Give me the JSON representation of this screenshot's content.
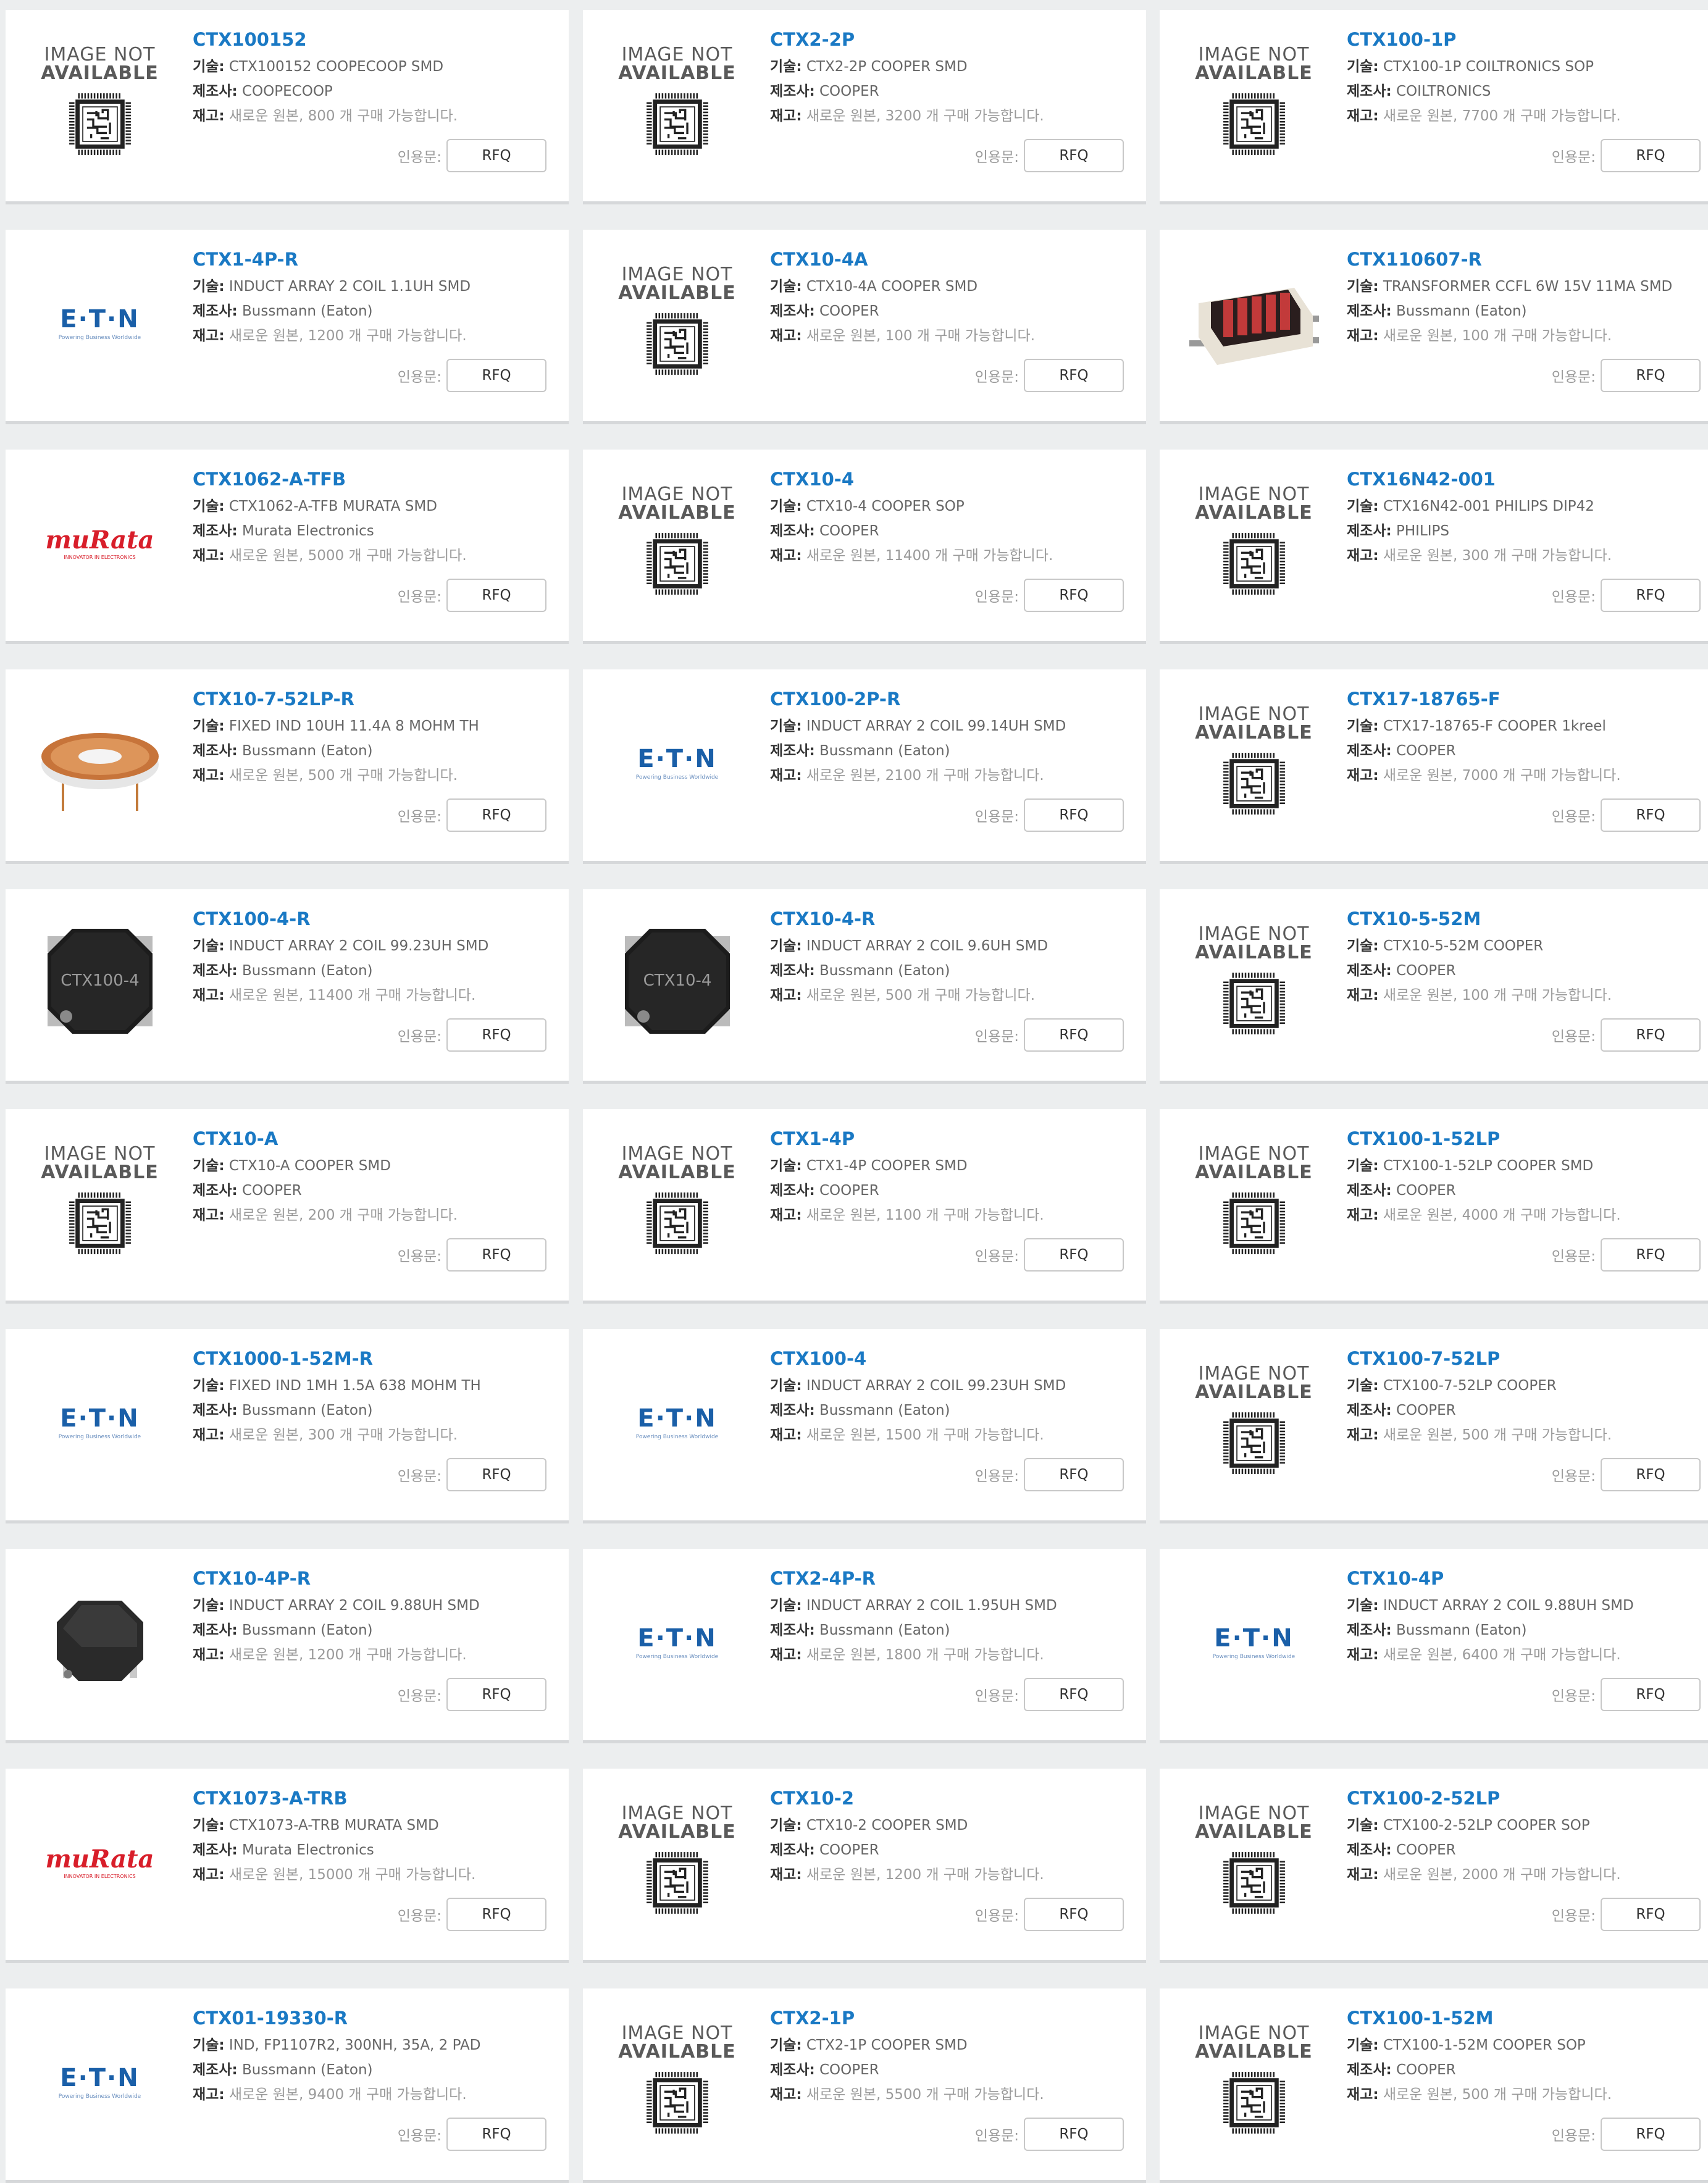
{
  "labels": {
    "desc": "기술:",
    "mfr": "제조사:",
    "stock": "재고:",
    "quote": "인용문:",
    "rfq": "RFQ",
    "na_line1": "IMAGE NOT",
    "na_line2": "AVAILABLE"
  },
  "logos": {
    "eaton": "E·T·N",
    "eaton_tag": "Powering Business Worldwide",
    "murata": "muRata",
    "murata_tag": "INNOVATOR IN ELECTRONICS"
  },
  "products": [
    {
      "name": "CTX100152",
      "desc": "CTX100152 COOPECOOP SMD",
      "mfr": "COOPECOOP",
      "stock": "새로운 원본, 800 개 구매 가능합니다.",
      "image": "na"
    },
    {
      "name": "CTX2-2P",
      "desc": "CTX2-2P COOPER SMD",
      "mfr": "COOPER",
      "stock": "새로운 원본, 3200 개 구매 가능합니다.",
      "image": "na"
    },
    {
      "name": "CTX100-1P",
      "desc": "CTX100-1P COILTRONICS SOP",
      "mfr": "COILTRONICS",
      "stock": "새로운 원본, 7700 개 구매 가능합니다.",
      "image": "na"
    },
    {
      "name": "CTX1-4P-R",
      "desc": "INDUCT ARRAY 2 COIL 1.1UH SMD",
      "mfr": "Bussmann (Eaton)",
      "stock": "새로운 원본, 1200 개 구매 가능합니다.",
      "image": "eaton"
    },
    {
      "name": "CTX10-4A",
      "desc": "CTX10-4A COOPER SMD",
      "mfr": "COOPER",
      "stock": "새로운 원본, 100 개 구매 가능합니다.",
      "image": "na"
    },
    {
      "name": "CTX110607-R",
      "desc": "TRANSFORMER CCFL 6W 15V 11MA SMD",
      "mfr": "Bussmann (Eaton)",
      "stock": "새로운 원본, 100 개 구매 가능합니다.",
      "image": "transformer"
    },
    {
      "name": "CTX1062-A-TFB",
      "desc": "CTX1062-A-TFB MURATA SMD",
      "mfr": "Murata Electronics",
      "stock": "새로운 원본, 5000 개 구매 가능합니다.",
      "image": "murata"
    },
    {
      "name": "CTX10-4",
      "desc": "CTX10-4 COOPER SOP",
      "mfr": "COOPER",
      "stock": "새로운 원본, 11400 개 구매 가능합니다.",
      "image": "na"
    },
    {
      "name": "CTX16N42-001",
      "desc": "CTX16N42-001 PHILIPS DIP42",
      "mfr": "PHILIPS",
      "stock": "새로운 원본, 300 개 구매 가능합니다.",
      "image": "na"
    },
    {
      "name": "CTX10-7-52LP-R",
      "desc": "FIXED IND 10UH 11.4A 8 MOHM TH",
      "mfr": "Bussmann (Eaton)",
      "stock": "새로운 원본, 500 개 구매 가능합니다.",
      "image": "coil"
    },
    {
      "name": "CTX100-2P-R",
      "desc": "INDUCT ARRAY 2 COIL 99.14UH SMD",
      "mfr": "Bussmann (Eaton)",
      "stock": "새로운 원본, 2100 개 구매 가능합니다.",
      "image": "eaton"
    },
    {
      "name": "CTX17-18765-F",
      "desc": "CTX17-18765-F COOPER 1kreel",
      "mfr": "COOPER",
      "stock": "새로운 원본, 7000 개 구매 가능합니다.",
      "image": "na"
    },
    {
      "name": "CTX100-4-R",
      "desc": "INDUCT ARRAY 2 COIL 99.23UH SMD",
      "mfr": "Bussmann (Eaton)",
      "stock": "새로운 원본, 11400 개 구매 가능합니다.",
      "image": "inductor",
      "chip_label": "CTX100-4"
    },
    {
      "name": "CTX10-4-R",
      "desc": "INDUCT ARRAY 2 COIL 9.6UH SMD",
      "mfr": "Bussmann (Eaton)",
      "stock": "새로운 원본, 500 개 구매 가능합니다.",
      "image": "inductor",
      "chip_label": "CTX10-4"
    },
    {
      "name": "CTX10-5-52M",
      "desc": "CTX10-5-52M COOPER",
      "mfr": "COOPER",
      "stock": "새로운 원본, 100 개 구매 가능합니다.",
      "image": "na"
    },
    {
      "name": "CTX10-A",
      "desc": "CTX10-A COOPER SMD",
      "mfr": "COOPER",
      "stock": "새로운 원본, 200 개 구매 가능합니다.",
      "image": "na"
    },
    {
      "name": "CTX1-4P",
      "desc": "CTX1-4P COOPER SMD",
      "mfr": "COOPER",
      "stock": "새로운 원본, 1100 개 구매 가능합니다.",
      "image": "na"
    },
    {
      "name": "CTX100-1-52LP",
      "desc": "CTX100-1-52LP COOPER SMD",
      "mfr": "COOPER",
      "stock": "새로운 원본, 4000 개 구매 가능합니다.",
      "image": "na"
    },
    {
      "name": "CTX1000-1-52M-R",
      "desc": "FIXED IND 1MH 1.5A 638 MOHM TH",
      "mfr": "Bussmann (Eaton)",
      "stock": "새로운 원본, 300 개 구매 가능합니다.",
      "image": "eaton"
    },
    {
      "name": "CTX100-4",
      "desc": "INDUCT ARRAY 2 COIL 99.23UH SMD",
      "mfr": "Bussmann (Eaton)",
      "stock": "새로운 원본, 1500 개 구매 가능합니다.",
      "image": "eaton"
    },
    {
      "name": "CTX100-7-52LP",
      "desc": "CTX100-7-52LP COOPER",
      "mfr": "COOPER",
      "stock": "새로운 원본, 500 개 구매 가능합니다.",
      "image": "na"
    },
    {
      "name": "CTX10-4P-R",
      "desc": "INDUCT ARRAY 2 COIL 9.88UH SMD",
      "mfr": "Bussmann (Eaton)",
      "stock": "새로운 원본, 1200 개 구매 가능합니다.",
      "image": "octagon"
    },
    {
      "name": "CTX2-4P-R",
      "desc": "INDUCT ARRAY 2 COIL 1.95UH SMD",
      "mfr": "Bussmann (Eaton)",
      "stock": "새로운 원본, 1800 개 구매 가능합니다.",
      "image": "eaton"
    },
    {
      "name": "CTX10-4P",
      "desc": "INDUCT ARRAY 2 COIL 9.88UH SMD",
      "mfr": "Bussmann (Eaton)",
      "stock": "새로운 원본, 6400 개 구매 가능합니다.",
      "image": "eaton"
    },
    {
      "name": "CTX1073-A-TRB",
      "desc": "CTX1073-A-TRB MURATA SMD",
      "mfr": "Murata Electronics",
      "stock": "새로운 원본, 15000 개 구매 가능합니다.",
      "image": "murata"
    },
    {
      "name": "CTX10-2",
      "desc": "CTX10-2 COOPER SMD",
      "mfr": "COOPER",
      "stock": "새로운 원본, 1200 개 구매 가능합니다.",
      "image": "na"
    },
    {
      "name": "CTX100-2-52LP",
      "desc": "CTX100-2-52LP COOPER SOP",
      "mfr": "COOPER",
      "stock": "새로운 원본, 2000 개 구매 가능합니다.",
      "image": "na"
    },
    {
      "name": "CTX01-19330-R",
      "desc": "IND, FP1107R2, 300NH, 35A, 2 PAD",
      "mfr": "Bussmann (Eaton)",
      "stock": "새로운 원본, 9400 개 구매 가능합니다.",
      "image": "eaton"
    },
    {
      "name": "CTX2-1P",
      "desc": "CTX2-1P COOPER SMD",
      "mfr": "COOPER",
      "stock": "새로운 원본, 5500 개 구매 가능합니다.",
      "image": "na"
    },
    {
      "name": "CTX100-1-52M",
      "desc": "CTX100-1-52M COOPER SOP",
      "mfr": "COOPER",
      "stock": "새로운 원본, 500 개 구매 가능합니다.",
      "image": "na"
    }
  ]
}
